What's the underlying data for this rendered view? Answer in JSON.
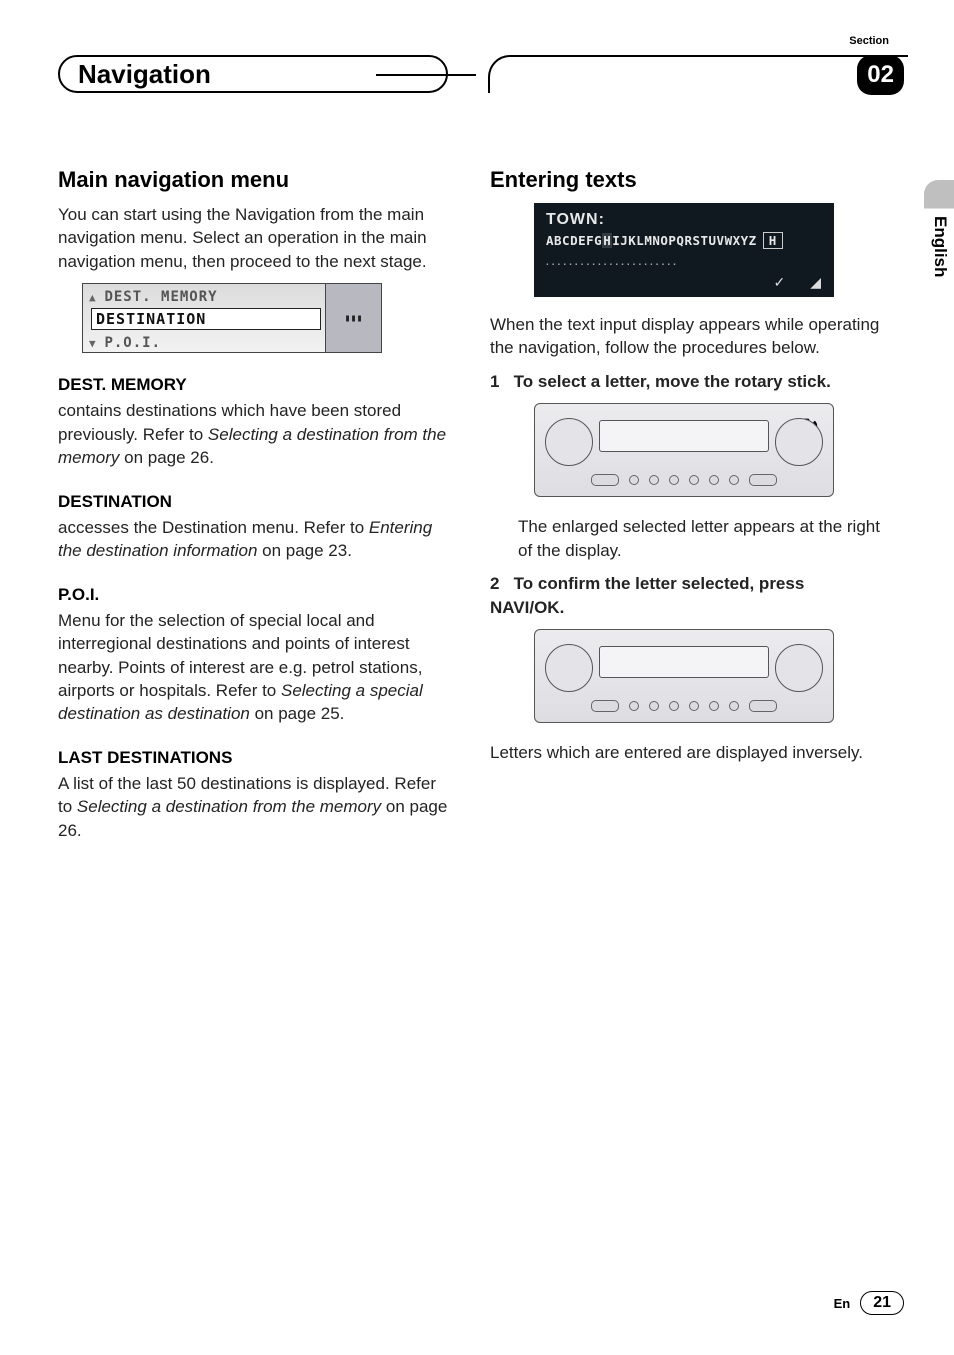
{
  "header": {
    "section_label": "Section",
    "section_number": "02",
    "nav_title": "Navigation"
  },
  "language_tab": "English",
  "left": {
    "h2": "Main navigation menu",
    "intro": "You can start using the Navigation from the main navigation menu. Select an operation in the main navigation menu, then proceed to the next stage.",
    "lcd": {
      "row1": "DEST. MEMORY",
      "row2": "DESTINATION",
      "row3": "P.O.I."
    },
    "dest_mem_h": "DEST. MEMORY",
    "dest_mem_p_a": "contains destinations which have been stored previously. Refer to ",
    "dest_mem_p_i": "Selecting a destination from the memory",
    "dest_mem_p_b": " on page 26.",
    "dest_h": "DESTINATION",
    "dest_p_a": "accesses the Destination menu. Refer to ",
    "dest_p_i": "Entering the destination information",
    "dest_p_b": " on page 23.",
    "poi_h": "P.O.I.",
    "poi_p_a": "Menu for the selection of special local and interregional destinations and points of interest nearby. Points of interest are e.g. petrol stations, airports or hospitals. Refer to ",
    "poi_p_i": "Selecting a special destination as destination",
    "poi_p_b": " on page 25.",
    "last_h": "LAST DESTINATIONS",
    "last_p_a": "A list of the last 50 destinations is displayed. Refer to ",
    "last_p_i": "Selecting a destination from the memory",
    "last_p_b": " on page 26."
  },
  "right": {
    "h2": "Entering texts",
    "lcd2": {
      "line1": "TOWN:",
      "line2_a": "ABCDEFG",
      "line2_hi": "H",
      "line2_b": "IJKLMNOPQRSTUVWXYZ",
      "line2_box": "H",
      "dots": "......................."
    },
    "intro": "When the text input display appears while operating the navigation, follow the procedures below.",
    "step1_num": "1",
    "step1_txt": "To select a letter, move the rotary stick.",
    "step1_after": "The enlarged selected letter appears at the right of the display.",
    "step2_num": "2",
    "step2_txt": "To confirm the letter selected, press NAVI/OK.",
    "step2_after": "Letters which are entered are displayed inversely."
  },
  "footer": {
    "lang_code": "En",
    "page": "21"
  }
}
